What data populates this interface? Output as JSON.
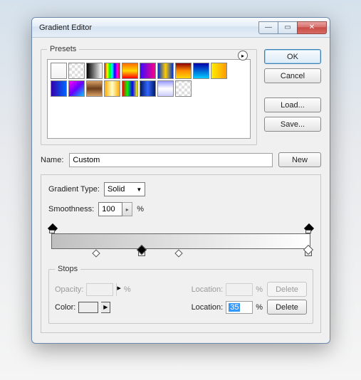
{
  "window": {
    "title": "Gradient Editor"
  },
  "buttons": {
    "ok": "OK",
    "cancel": "Cancel",
    "load": "Load...",
    "save": "Save...",
    "new": "New",
    "delete": "Delete"
  },
  "presets_legend": "Presets",
  "name": {
    "label": "Name:",
    "value": "Custom"
  },
  "gradientType": {
    "label": "Gradient Type:",
    "value": "Solid"
  },
  "smoothness": {
    "label": "Smoothness:",
    "value": "100",
    "unit": "%"
  },
  "ramp": {
    "opacity_stops": [
      0,
      100
    ],
    "midpoints": [
      17,
      48
    ],
    "color_stops": [
      {
        "pos": 35,
        "color": "#d8d8d8",
        "active": true
      },
      {
        "pos": 100,
        "color": "#ffffff",
        "active": false
      }
    ]
  },
  "stops": {
    "legend": "Stops",
    "opacity": {
      "label": "Opacity:",
      "value": "",
      "unit": "%"
    },
    "opLocation": {
      "label": "Location:",
      "value": "",
      "unit": "%"
    },
    "color": {
      "label": "Color:"
    },
    "colLocation": {
      "label": "Location:",
      "value": "35",
      "unit": "%"
    }
  },
  "presets": [
    "linear-gradient(to bottom,#ffffff,#f2f2f2)",
    "repeating-conic-gradient(#fff 0 25%,#ddd 0 50%) 0/8px 8px",
    "linear-gradient(to right,#000,#fff)",
    "linear-gradient(to right,#ff0000,#ffff00,#00ff00,#00ffff,#0000ff,#ff00ff,#ff0000)",
    "linear-gradient(to bottom,#ff6a00,#ffd800,#ff0000)",
    "linear-gradient(to right,#3b0bff,#ff0088)",
    "linear-gradient(to right,#0033cc,#ffcc00,#0033cc)",
    "linear-gradient(to bottom,#8b0000,#ff8c00,#ffd700)",
    "linear-gradient(to bottom,#0000aa,#00ccff)",
    "linear-gradient(to right,#ffee00,#ff9900)",
    "linear-gradient(to right,#3300aa,#0066ff)",
    "linear-gradient(135deg,#ff00ff,#6600ff,#00ccff)",
    "linear-gradient(to bottom,#d9a066,#6b3e1b,#d9a066)",
    "linear-gradient(to right,#ffaa00,#ffffcc,#ffaa00)",
    "linear-gradient(to right,#ff0000,#00ff00,#0000ff,#ffff00)",
    "linear-gradient(to right,#001a66,#3366ff,#001a66)",
    "linear-gradient(to bottom,#9999ff,#ffffff,#ccccff)",
    "repeating-conic-gradient(#fff 0 25%,#ddd 0 50%) 0/8px 8px"
  ]
}
